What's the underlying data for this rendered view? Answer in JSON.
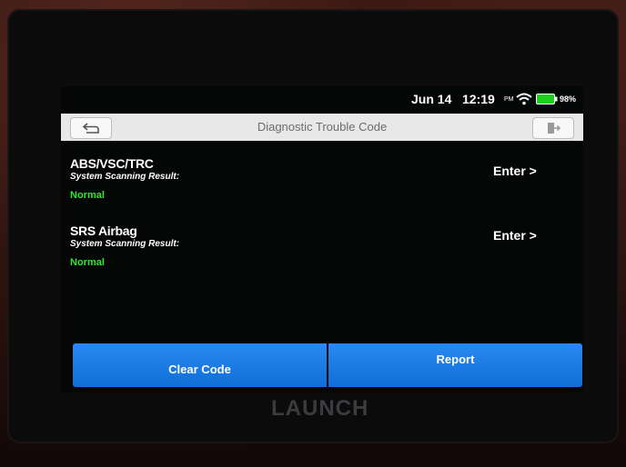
{
  "status": {
    "date": "Jun 14",
    "time": "12:19",
    "ampm": "PM",
    "battery": "98%"
  },
  "header": {
    "title": "Diagnostic Trouble Code"
  },
  "systems": [
    {
      "name": "ABS/VSC/TRC",
      "label": "System Scanning Result:",
      "status": "Normal",
      "enter": "Enter >"
    },
    {
      "name": "SRS Airbag",
      "label": "System Scanning Result:",
      "status": "Normal",
      "enter": "Enter >"
    }
  ],
  "actions": {
    "clear_code": "Clear Code",
    "report": "Report"
  },
  "device": {
    "brand": "LAUNCH"
  },
  "colors": {
    "status_normal": "#2ee62e",
    "button_blue": "#1a7ce6"
  },
  "icons": [
    "back-icon",
    "exit-icon",
    "wifi-icon",
    "battery-icon"
  ]
}
